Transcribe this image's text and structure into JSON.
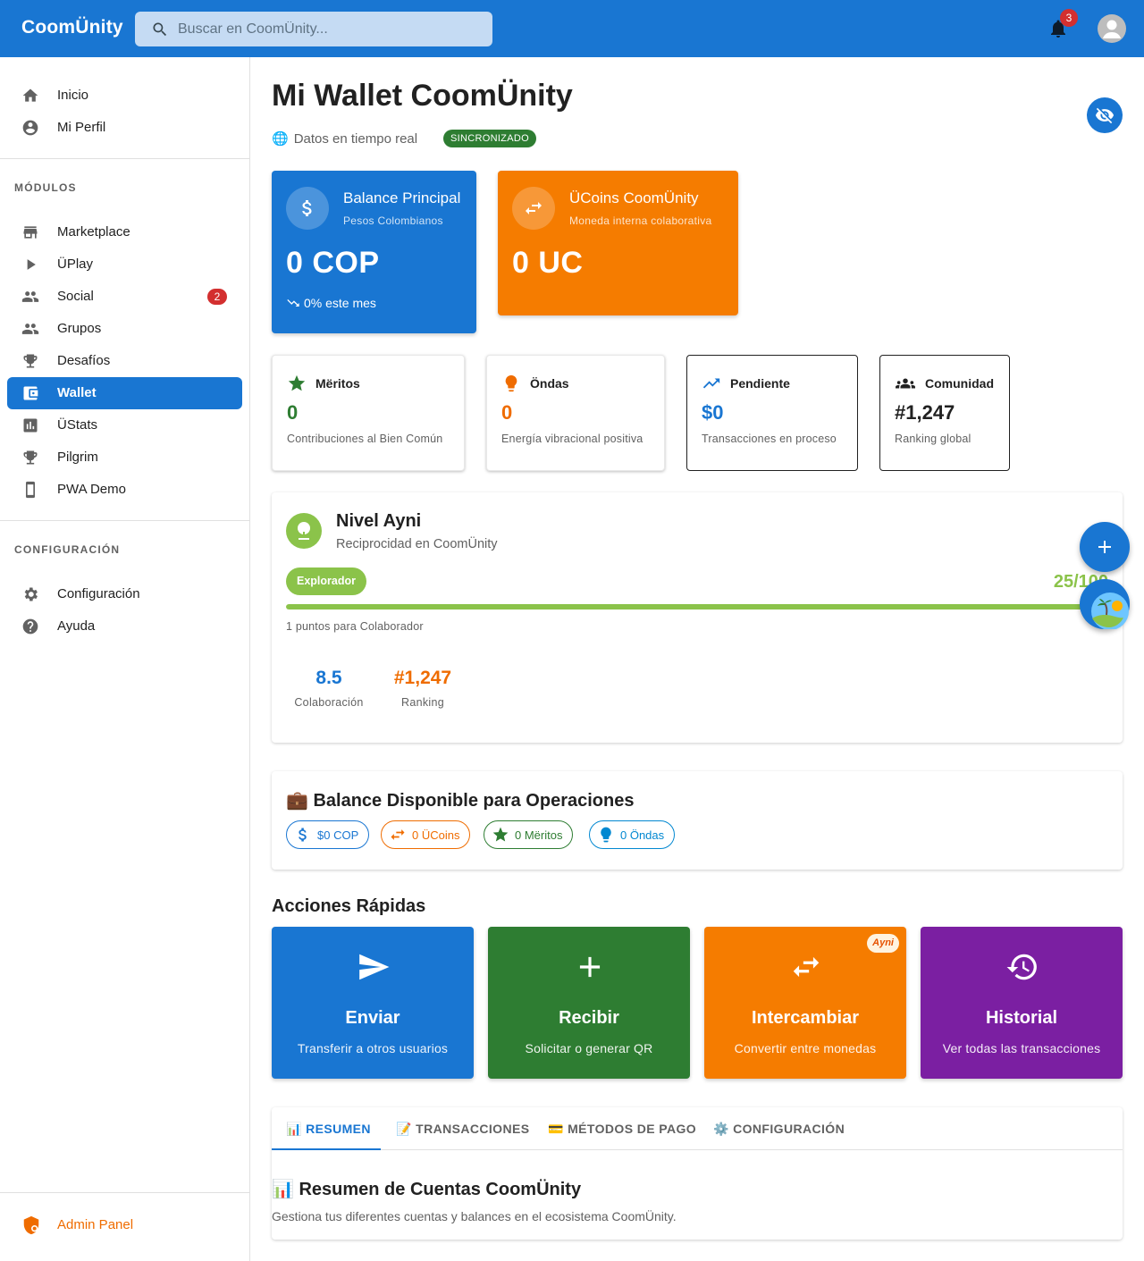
{
  "app": {
    "brand": "CoomÜnity",
    "search_placeholder": "Buscar en CoomÜnity...",
    "notifications_count": "3"
  },
  "sidebar": {
    "top_items": [
      {
        "label": "Inicio",
        "icon": "home-icon"
      },
      {
        "label": "Mi Perfil",
        "icon": "account-circle-icon"
      }
    ],
    "modules_title": "MÓDULOS",
    "modules": [
      {
        "label": "Marketplace",
        "icon": "store-icon"
      },
      {
        "label": "ÜPlay",
        "icon": "play-icon"
      },
      {
        "label": "Social",
        "icon": "people-icon",
        "badge": "2"
      },
      {
        "label": "Grupos",
        "icon": "groups-icon"
      },
      {
        "label": "Desafíos",
        "icon": "trophy-icon"
      },
      {
        "label": "Wallet",
        "icon": "wallet-icon",
        "active": true
      },
      {
        "label": "ÜStats",
        "icon": "stats-icon"
      },
      {
        "label": "Pilgrim",
        "icon": "trophy-icon"
      },
      {
        "label": "PWA Demo",
        "icon": "phone-icon"
      }
    ],
    "config_title": "CONFIGURACIÓN",
    "config_items": [
      {
        "label": "Configuración",
        "icon": "gear-icon"
      },
      {
        "label": "Ayuda",
        "icon": "help-icon"
      }
    ],
    "admin_label": "Admin Panel"
  },
  "header": {
    "title": "Mi Wallet CoomÜnity",
    "realtime": "Datos en tiempo real",
    "sync_status": "SINCRONIZADO"
  },
  "balance_cards": {
    "main": {
      "title": "Balance Principal",
      "subtitle": "Pesos Colombianos",
      "amount": "0 COP",
      "trend": "0% este mes"
    },
    "ucoins": {
      "title": "ÜCoins CoomÜnity",
      "subtitle": "Moneda interna colaborativa",
      "amount": "0 UC"
    }
  },
  "stats": {
    "meritos": {
      "title": "Mëritos",
      "value": "0",
      "desc": "Contribuciones al Bien Común"
    },
    "ondas": {
      "title": "Öndas",
      "value": "0",
      "desc": "Energía vibracional positiva"
    },
    "pendiente": {
      "title": "Pendiente",
      "value": "$0",
      "desc": "Transacciones en proceso"
    },
    "comunidad": {
      "title": "Comunidad",
      "value": "#1,247",
      "desc": "Ranking global"
    }
  },
  "ayni": {
    "title": "Nivel Ayni",
    "subtitle": "Reciprocidad en CoomÜnity",
    "level": "Explorador",
    "score": "25/100",
    "progress": 0.99,
    "next_level": "1 puntos para Colaborador",
    "collab_value": "8.5",
    "collab_label": "Colaboración",
    "rank_value": "#1,247",
    "rank_label": "Ranking"
  },
  "available": {
    "title": "💼 Balance Disponible para Operaciones",
    "chips": [
      "$0 COP",
      "0 ÜCoins",
      "0 Mëritos",
      "0 Öndas"
    ]
  },
  "quick_actions": {
    "title": "Acciones Rápidas",
    "items": [
      {
        "name": "Enviar",
        "desc": "Transferir a otros usuarios"
      },
      {
        "name": "Recibir",
        "desc": "Solicitar o generar QR"
      },
      {
        "name": "Intercambiar",
        "desc": "Convertir entre monedas",
        "badge": "Ayni"
      },
      {
        "name": "Historial",
        "desc": "Ver todas las transacciones"
      }
    ]
  },
  "tabs": {
    "items": [
      "📊 RESUMEN",
      "📝 TRANSACCIONES",
      "💳 MÉTODOS DE PAGO",
      "⚙️ CONFIGURACIÓN"
    ],
    "summary_title": "📊 Resumen de Cuentas CoomÜnity",
    "summary_desc": "Gestiona tus diferentes cuentas y balances en el ecosistema CoomÜnity."
  },
  "colors": {
    "primary": "#1976d2",
    "orange": "#f57c00",
    "green": "#2e7d32",
    "purple": "#7b1fa2",
    "lime": "#8bc34a",
    "error": "#d32f2f"
  }
}
